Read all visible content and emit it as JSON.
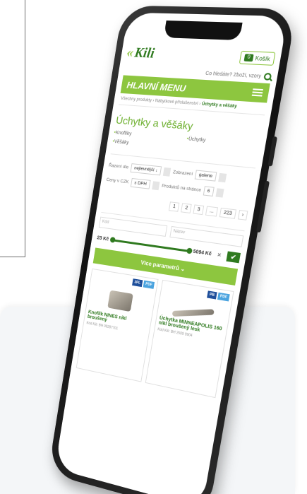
{
  "header": {
    "logo": "Kili",
    "logo_mark": "«",
    "cart_label": "Košík",
    "cart_count": "0"
  },
  "search": {
    "placeholder": "Co hledáte? Zboží, vzory"
  },
  "menu": {
    "label": "HLAVNÍ MENU"
  },
  "breadcrumb": {
    "items": [
      "Všechny produkty",
      "Nábytkové příslušenství"
    ],
    "current": "Úchytky a věšáky"
  },
  "page": {
    "title": "Úchytky a věšáky"
  },
  "categories": [
    "Knoflíky",
    "Úchytky",
    "Věšáky"
  ],
  "filters": {
    "sort_label": "Řazení dle",
    "sort_value": "nejlevnější",
    "sort_arrow": "↓",
    "display_label": "Zobrazení",
    "display_value": "galerie",
    "price_label": "Ceny v CZK",
    "price_value": "s DPH",
    "per_page_label": "Produktů na stránce",
    "per_page_value": "6"
  },
  "pager": {
    "pages": [
      "1",
      "2",
      "3",
      "...",
      "223"
    ],
    "next": "›"
  },
  "price_range": {
    "from_placeholder": "Kód",
    "to_placeholder": "Název",
    "min": "23 Kč",
    "max": "5094 Kč",
    "clear": "✕",
    "confirm": "✔"
  },
  "more_params": {
    "label": "Více parametrů ⌄"
  },
  "products": [
    {
      "name": "Knoflík NINES nikl broušený",
      "code": "Kód Kili: BH 09287701",
      "badges": [
        "3PL",
        "PDF"
      ]
    },
    {
      "name": "Úchytka MINNEAPOLIS 160 nikl broušený lesk",
      "code": "Kód Kili: BH 2509 9904",
      "badges": [
        "PB",
        "PDF"
      ]
    }
  ],
  "colors": {
    "accent": "#8dc63f",
    "dark_green": "#2f7a1f",
    "badge_blue": "#1f4f9b",
    "badge_light": "#4aa3df"
  }
}
